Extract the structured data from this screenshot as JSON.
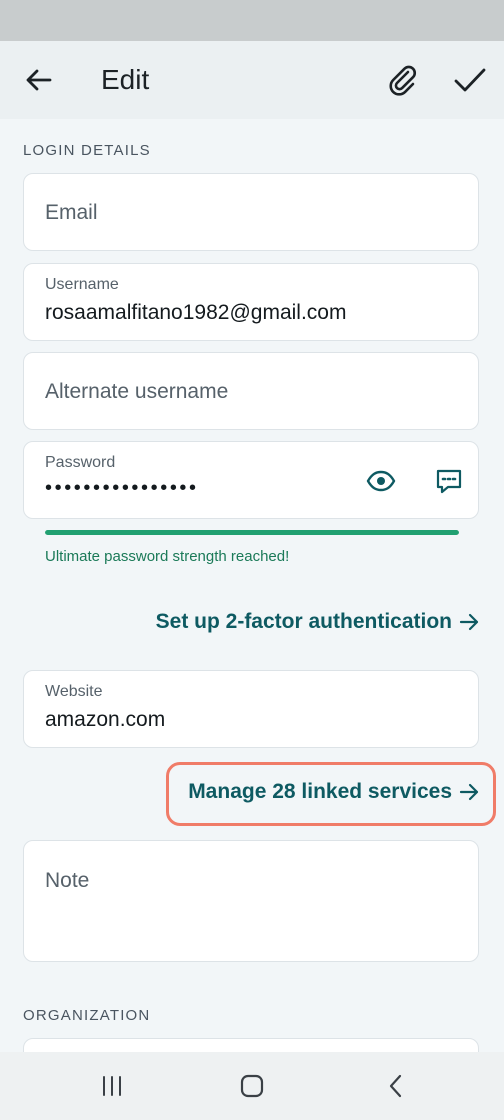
{
  "header": {
    "title": "Edit",
    "back_icon": "arrow-left-icon",
    "attach_icon": "paperclip-icon",
    "save_icon": "checkmark-icon"
  },
  "login_details": {
    "section_label": "LOGIN DETAILS",
    "email": {
      "placeholder": "Email"
    },
    "username": {
      "label": "Username",
      "value": "rosaamalfitano1982@gmail.com"
    },
    "alternate_username": {
      "placeholder": "Alternate username"
    },
    "password": {
      "label": "Password",
      "masked_value": "••••••••••••••••",
      "strength_fraction": 1.0,
      "strength_text": "Ultimate password strength reached!"
    },
    "two_factor_link": "Set up 2-factor authentication",
    "website": {
      "label": "Website",
      "value": "amazon.com"
    },
    "linked_services_link": "Manage 28 linked services",
    "note": {
      "placeholder": "Note"
    }
  },
  "organization": {
    "section_label": "ORGANIZATION"
  },
  "colors": {
    "accent": "#0e5a62",
    "strength": "#21a071",
    "highlight": "#f07c68"
  }
}
